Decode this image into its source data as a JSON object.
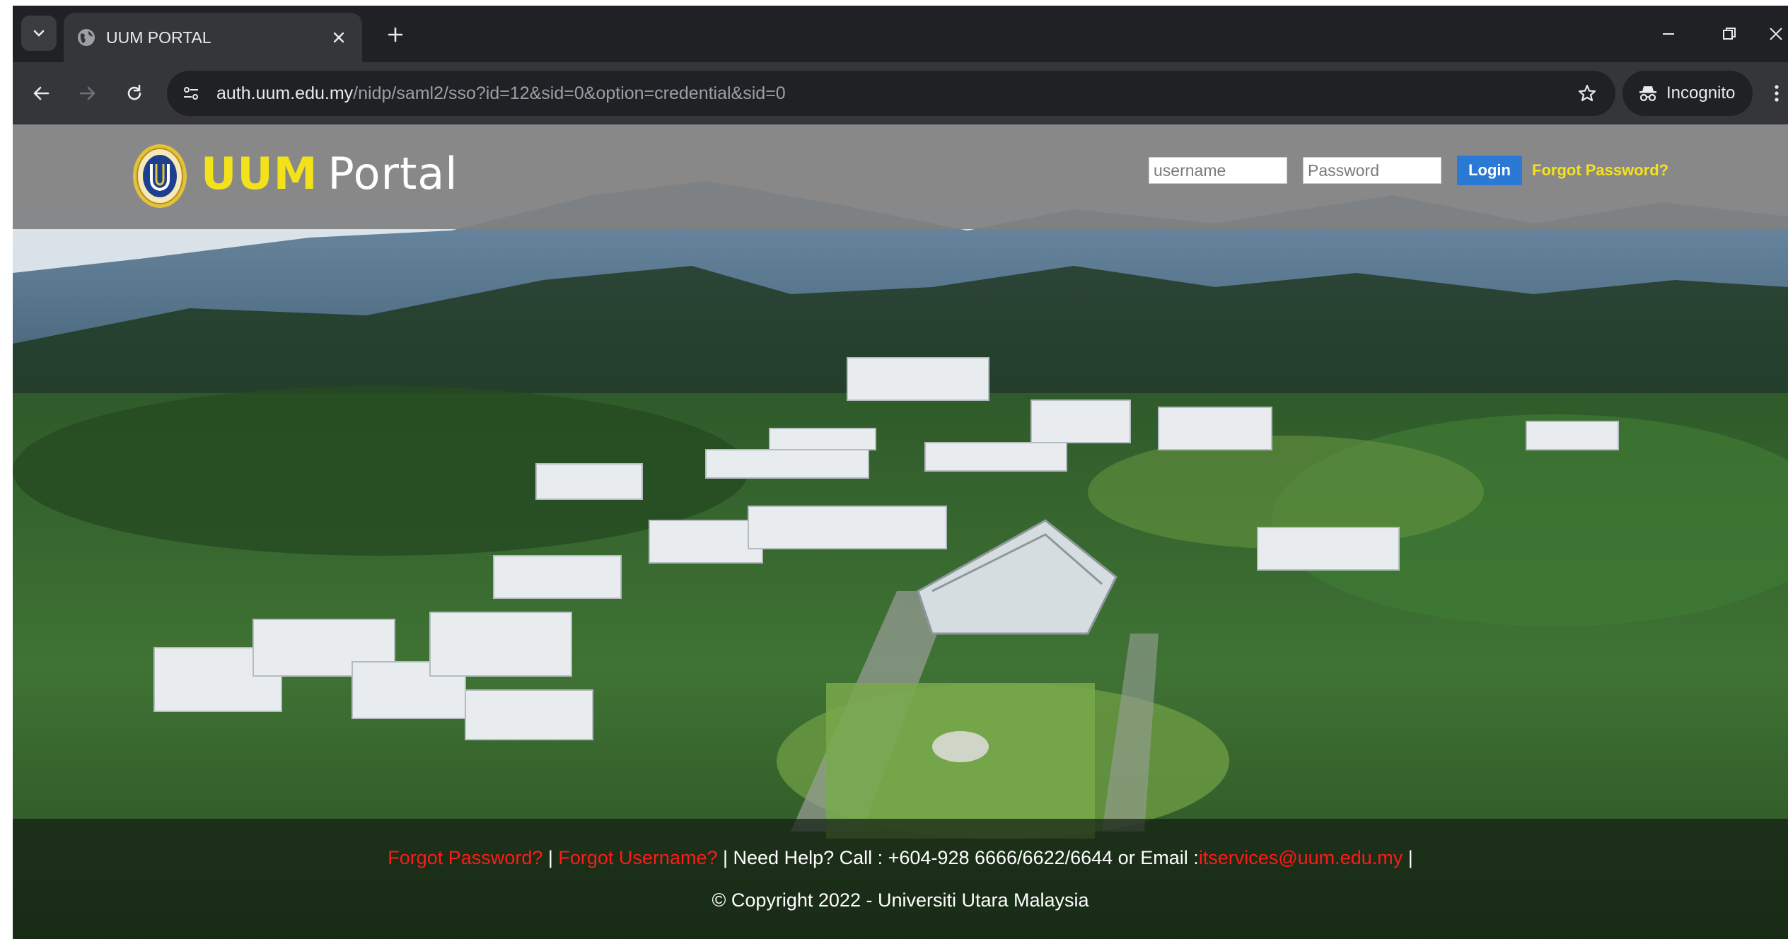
{
  "browser": {
    "tab_title": "UUM PORTAL",
    "url_host": "auth.uum.edu.my",
    "url_path": "/nidp/saml2/sso?id=12&sid=0&option=credential&sid=0",
    "incognito_label": "Incognito"
  },
  "header": {
    "logo_uum": "UUM",
    "logo_portal": "Portal",
    "username_placeholder": "username",
    "password_placeholder": "Password",
    "login_label": "Login",
    "forgot_password": "Forgot Password?"
  },
  "footer": {
    "forgot_password": "Forgot Password?",
    "separator": " | ",
    "forgot_username": "Forgot Username?",
    "help_text": " | Need Help? Call : +604-928 6666/6622/6644 or Email :",
    "email": "itservices@uum.edu.my",
    "trailing": " |",
    "copyright": "© Copyright 2022 - Universiti Utara Malaysia"
  },
  "colors": {
    "header_bg": "#808080",
    "logo_yellow": "#f3e21a",
    "login_button": "#2a7ad5",
    "link_red": "#ff1a1a",
    "forgot_yellow": "#f5e21e"
  },
  "icons": [
    "tab-search-icon",
    "globe-icon",
    "close-icon",
    "plus-icon",
    "minimize-icon",
    "restore-icon",
    "back-icon",
    "forward-icon",
    "reload-icon",
    "site-info-icon",
    "star-icon",
    "incognito-icon",
    "more-vert-icon",
    "uum-seal-logo"
  ]
}
